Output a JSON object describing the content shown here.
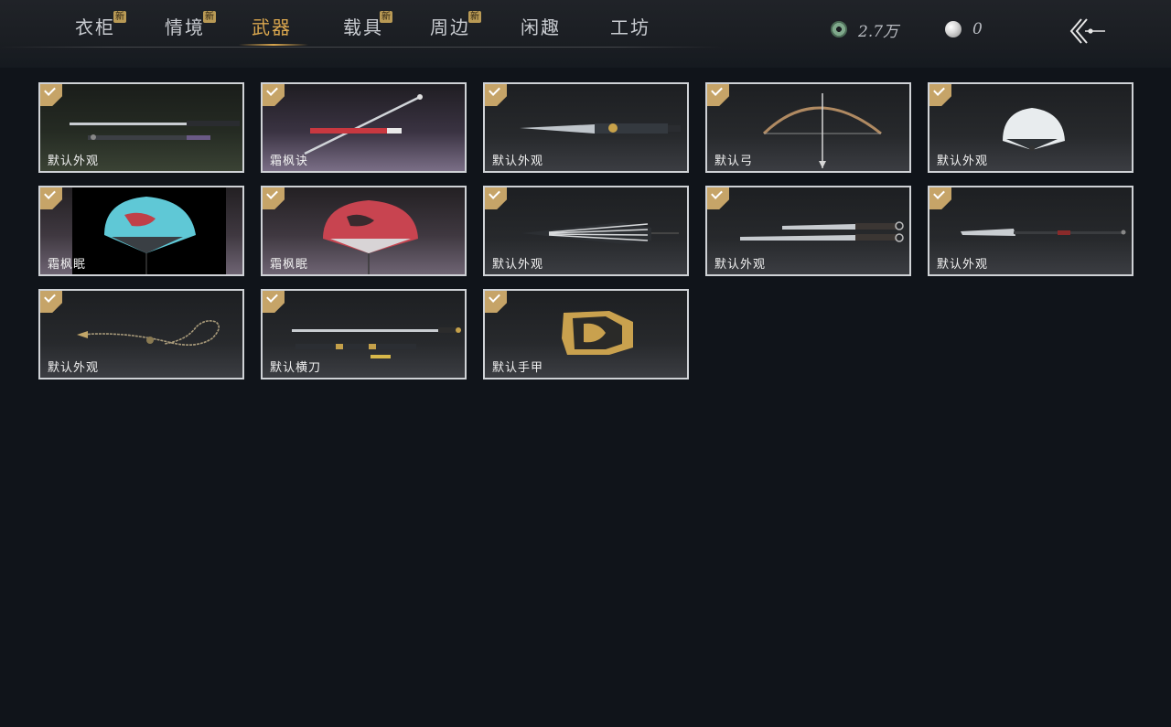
{
  "tabs": [
    {
      "label": "衣柜",
      "badge": "新"
    },
    {
      "label": "情境",
      "badge": "新"
    },
    {
      "label": "武器",
      "badge": ""
    },
    {
      "label": "载具",
      "badge": "新"
    },
    {
      "label": "周边",
      "badge": "新"
    },
    {
      "label": "闲趣",
      "badge": ""
    },
    {
      "label": "工坊",
      "badge": ""
    }
  ],
  "active_tab": "武器",
  "currency": {
    "coins": "2.7万",
    "pearls": "0"
  },
  "items": [
    {
      "name": "默认外观",
      "icon": "sword-pair-icon",
      "owned": true
    },
    {
      "name": "霜枫诀",
      "icon": "red-sword-icon",
      "owned": true
    },
    {
      "name": "默认外观",
      "icon": "ornate-blade-icon",
      "owned": true
    },
    {
      "name": "默认弓",
      "icon": "bow-icon",
      "owned": true
    },
    {
      "name": "默认外观",
      "icon": "folding-fan-icon",
      "owned": true
    },
    {
      "name": "霜枫眠",
      "icon": "blue-fan-icon",
      "owned": true
    },
    {
      "name": "霜枫眠",
      "icon": "red-fan-icon",
      "owned": true
    },
    {
      "name": "默认外观",
      "icon": "umbrella-icon",
      "owned": true
    },
    {
      "name": "默认外观",
      "icon": "twin-blades-icon",
      "owned": true
    },
    {
      "name": "默认外观",
      "icon": "long-blade-icon",
      "owned": true
    },
    {
      "name": "默认外观",
      "icon": "chain-whip-icon",
      "owned": true
    },
    {
      "name": "默认横刀",
      "icon": "hengdao-icon",
      "owned": true
    },
    {
      "name": "默认手甲",
      "icon": "gauntlet-icon",
      "owned": true
    }
  ]
}
